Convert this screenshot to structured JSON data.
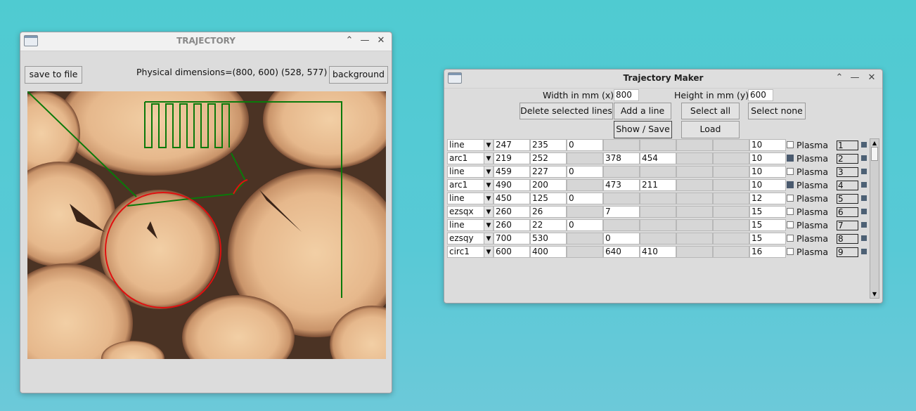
{
  "traj_window": {
    "title": "TRAJECTORY",
    "save_button": "save to file",
    "dimensions_text": "Physical dimensions=(800, 600) (528, 577)",
    "background_button": "background"
  },
  "maker_window": {
    "title": "Trajectory Maker",
    "width_label": "Width in mm (x)",
    "width_value": "800",
    "height_label": "Height in mm (y)",
    "height_value": "600",
    "delete_button": "Delete selected lines",
    "add_button": "Add a line",
    "select_all_button": "Select all",
    "select_none_button": "Select none",
    "show_save_button": "Show / Save",
    "load_button": "Load",
    "plasma_label": "Plasma",
    "rows": [
      {
        "type": "line",
        "c1": "247",
        "c2": "235",
        "c3": "0",
        "c4": "",
        "c5": "",
        "c6": "",
        "c7": "",
        "speed": "10",
        "plasma": false,
        "num": "1"
      },
      {
        "type": "arc1",
        "c1": "219",
        "c2": "252",
        "c3": "",
        "c4": "378",
        "c5": "454",
        "c6": "",
        "c7": "",
        "speed": "10",
        "plasma": true,
        "num": "2"
      },
      {
        "type": "line",
        "c1": "459",
        "c2": "227",
        "c3": "0",
        "c4": "",
        "c5": "",
        "c6": "",
        "c7": "",
        "speed": "10",
        "plasma": false,
        "num": "3"
      },
      {
        "type": "arc1",
        "c1": "490",
        "c2": "200",
        "c3": "",
        "c4": "473",
        "c5": "211",
        "c6": "",
        "c7": "",
        "speed": "10",
        "plasma": true,
        "num": "4"
      },
      {
        "type": "line",
        "c1": "450",
        "c2": "125",
        "c3": "0",
        "c4": "",
        "c5": "",
        "c6": "",
        "c7": "",
        "speed": "12",
        "plasma": false,
        "num": "5"
      },
      {
        "type": "ezsqx",
        "c1": "260",
        "c2": "26",
        "c3": "",
        "c4": "7",
        "c5": "",
        "c6": "",
        "c7": "",
        "speed": "15",
        "plasma": false,
        "num": "6"
      },
      {
        "type": "line",
        "c1": "260",
        "c2": "22",
        "c3": "0",
        "c4": "",
        "c5": "",
        "c6": "",
        "c7": "",
        "speed": "15",
        "plasma": false,
        "num": "7"
      },
      {
        "type": "ezsqy",
        "c1": "700",
        "c2": "530",
        "c3": "",
        "c4": "0",
        "c5": "",
        "c6": "",
        "c7": "",
        "speed": "15",
        "plasma": false,
        "num": "8"
      },
      {
        "type": "circ1",
        "c1": "600",
        "c2": "400",
        "c3": "",
        "c4": "640",
        "c5": "410",
        "c6": "",
        "c7": "",
        "speed": "16",
        "plasma": false,
        "num": "9"
      }
    ]
  },
  "colors": {
    "path_green": "#0a7a0a",
    "path_red": "#e01010",
    "accent": "#4d6175"
  }
}
